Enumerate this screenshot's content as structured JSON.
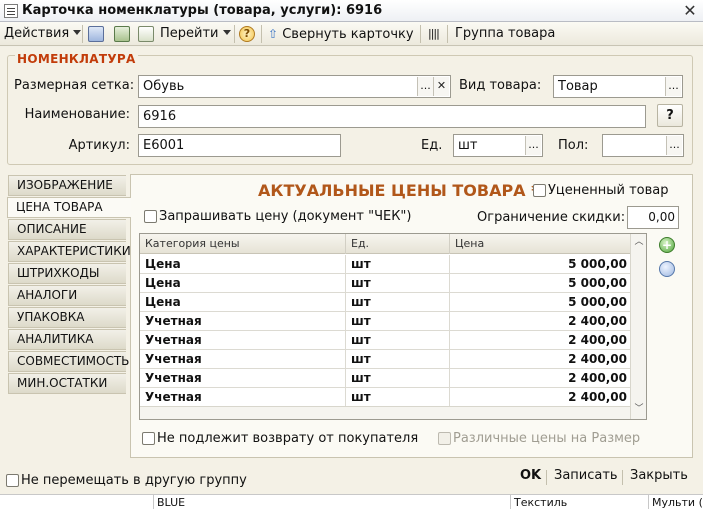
{
  "window": {
    "title": "Карточка номенклатуры (товара, услуги): 6916",
    "close_glyph": "✕"
  },
  "toolbar": {
    "actions_label": "Действия",
    "goto_label": "Перейти",
    "help_glyph": "?",
    "collapse_label": "Свернуть карточку",
    "group_label": "Группа товара"
  },
  "nomenclature": {
    "group_title": "НОМЕНКЛАТУРА",
    "size_grid_label": "Размерная сетка:",
    "size_grid_value": "Обувь",
    "product_kind_label": "Вид товара:",
    "product_kind_value": "Товар",
    "name_label": "Наименование:",
    "name_value": "6916",
    "help_button": "?",
    "article_label": "Артикул:",
    "article_value": "E6001",
    "unit_label": "Ед.",
    "unit_value": "шт",
    "gender_label": "Пол:",
    "gender_value": ""
  },
  "buttons": {
    "select_glyph": "...",
    "clear_glyph": "✕"
  },
  "tabs": [
    {
      "label": "ИЗОБРАЖЕНИЕ"
    },
    {
      "label": "ЦЕНА ТОВАРА"
    },
    {
      "label": "ОПИСАНИЕ"
    },
    {
      "label": "ХАРАКТЕРИСТИКИ"
    },
    {
      "label": "ШТРИХКОДЫ"
    },
    {
      "label": "АНАЛОГИ"
    },
    {
      "label": "УПАКОВКА"
    },
    {
      "label": "АНАЛИТИКА"
    },
    {
      "label": "СОВМЕСТИМОСТЬ"
    },
    {
      "label": "МИН.ОСТАТКИ"
    }
  ],
  "prices": {
    "title": "АКТУАЛЬНЫЕ ЦЕНЫ ТОВАРА *",
    "discounted_label": "Уцененный товар",
    "ask_price_label": "Запрашивать цену (документ \"ЧЕК\")",
    "discount_limit_label": "Ограничение скидки:",
    "discount_limit_value": "0,00",
    "columns": [
      "Категория цены",
      "Ед.",
      "Цена"
    ],
    "rows": [
      {
        "category": "Цена",
        "unit": "шт",
        "price": "5 000,00"
      },
      {
        "category": "Цена",
        "unit": "шт",
        "price": "5 000,00"
      },
      {
        "category": "Цена",
        "unit": "шт",
        "price": "5 000,00"
      },
      {
        "category": "Учетная",
        "unit": "шт",
        "price": "2 400,00"
      },
      {
        "category": "Учетная",
        "unit": "шт",
        "price": "2 400,00"
      },
      {
        "category": "Учетная",
        "unit": "шт",
        "price": "2 400,00"
      },
      {
        "category": "Учетная",
        "unit": "шт",
        "price": "2 400,00"
      },
      {
        "category": "Учетная",
        "unit": "шт",
        "price": "2 400,00"
      }
    ],
    "no_return_label": "Не подлежит возврату от покупателя",
    "size_prices_label": "Различные цены на Размер"
  },
  "footer": {
    "no_move_label": "Не перемещать в другую группу",
    "ok_label": "OK",
    "save_label": "Записать",
    "close_label": "Закрыть"
  },
  "statusbar": {
    "cells": [
      "BLUE",
      "Текстиль",
      "Мульти (т"
    ]
  },
  "colors": {
    "accent_title": "#c23c0a",
    "prices_title": "#b1571a"
  }
}
